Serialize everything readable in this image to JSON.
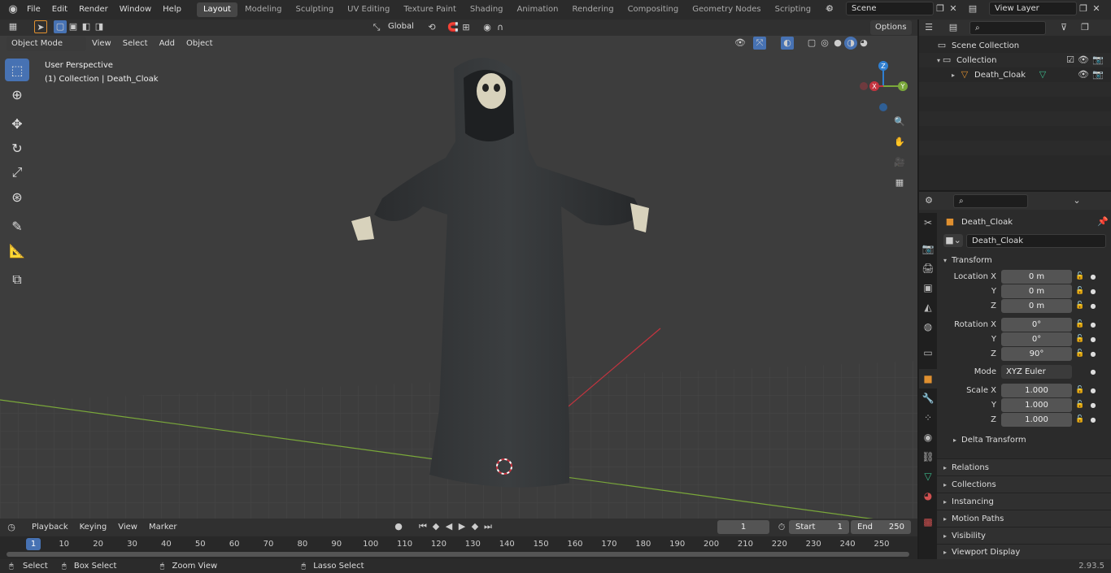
{
  "menu": {
    "items": [
      "File",
      "Edit",
      "Render",
      "Window",
      "Help"
    ]
  },
  "workspaces": {
    "tabs": [
      "Layout",
      "Modeling",
      "Sculpting",
      "UV Editing",
      "Texture Paint",
      "Shading",
      "Animation",
      "Rendering",
      "Compositing",
      "Geometry Nodes",
      "Scripting"
    ],
    "active": "Layout",
    "add": "+"
  },
  "scene": {
    "name": "Scene"
  },
  "view_layer": {
    "name": "View Layer"
  },
  "toolbar": {
    "transform_orientation": "Global",
    "options": "Options"
  },
  "viewport_header": {
    "mode": "Object Mode",
    "menus": [
      "View",
      "Select",
      "Add",
      "Object"
    ]
  },
  "viewport": {
    "perspective": "User Perspective",
    "collection_info": "(1) Collection | Death_Cloak",
    "gizmo_x": "X",
    "gizmo_y": "Y",
    "gizmo_z": "Z"
  },
  "outliner": {
    "scene_collection": "Scene Collection",
    "collection": "Collection",
    "object": "Death_Cloak"
  },
  "properties": {
    "object_name": "Death_Cloak",
    "data_name": "Death_Cloak",
    "transform_header": "Transform",
    "location_label": "Location X",
    "location": [
      "0 m",
      "0 m",
      "0 m"
    ],
    "rotation_label": "Rotation X",
    "rotation": [
      "0°",
      "0°",
      "90°"
    ],
    "mode_label": "Mode",
    "mode_value": "XYZ Euler",
    "scale_label": "Scale X",
    "scale": [
      "1.000",
      "1.000",
      "1.000"
    ],
    "axis_y": "Y",
    "axis_z": "Z",
    "delta_transform": "Delta Transform",
    "sections": [
      "Relations",
      "Collections",
      "Instancing",
      "Motion Paths",
      "Visibility",
      "Viewport Display"
    ]
  },
  "timeline": {
    "menus": [
      "Playback",
      "Keying",
      "View",
      "Marker"
    ],
    "current_frame": "1",
    "start_label": "Start",
    "start": "1",
    "end_label": "End",
    "end": "250",
    "ticks": [
      "1",
      "10",
      "20",
      "30",
      "40",
      "50",
      "60",
      "70",
      "80",
      "90",
      "100",
      "110",
      "120",
      "130",
      "140",
      "150",
      "160",
      "170",
      "180",
      "190",
      "200",
      "210",
      "220",
      "230",
      "240",
      "250"
    ]
  },
  "statusbar": {
    "select": "Select",
    "box_select": "Box Select",
    "zoom_view": "Zoom View",
    "lasso_select": "Lasso Select",
    "version": "2.93.5"
  },
  "colors": {
    "accent": "#4772b3",
    "x_axis": "#c4343f",
    "y_axis": "#7aa83a",
    "z_axis": "#2f7fd1",
    "viewport_bg": "#3d3d3d"
  }
}
